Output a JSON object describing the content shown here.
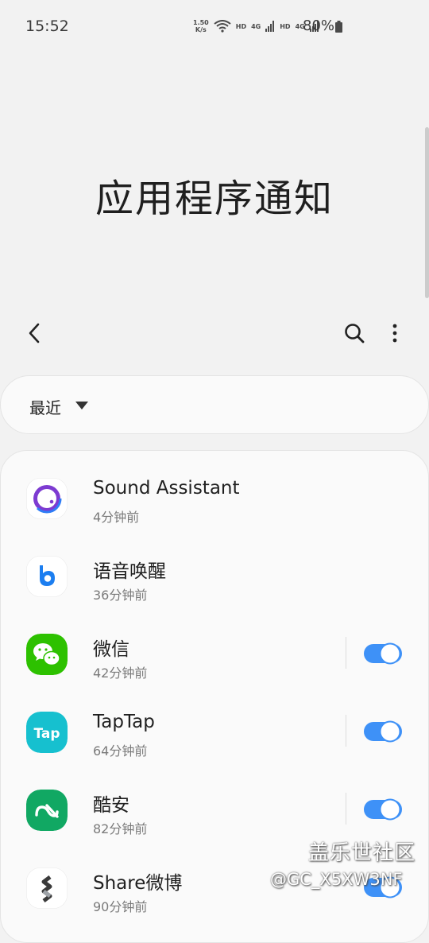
{
  "status_bar": {
    "time": "15:52",
    "net_speed_value": "1.50",
    "net_speed_unit": "K/s",
    "hd1": "HD",
    "hd2": "HD",
    "net1": "4G",
    "net2": "4G",
    "battery": "80%"
  },
  "page": {
    "title": "应用程序通知"
  },
  "filter": {
    "label": "最近"
  },
  "apps": [
    {
      "name": "Sound Assistant",
      "time": "4分钟前",
      "has_toggle": false,
      "icon": "sound-assistant-icon"
    },
    {
      "name": "语音唤醒",
      "time": "36分钟前",
      "has_toggle": false,
      "icon": "bixby-voice-icon"
    },
    {
      "name": "微信",
      "time": "42分钟前",
      "has_toggle": true,
      "toggle_on": true,
      "icon": "wechat-icon"
    },
    {
      "name": "TapTap",
      "time": "64分钟前",
      "has_toggle": true,
      "toggle_on": true,
      "icon": "taptap-icon"
    },
    {
      "name": "酷安",
      "time": "82分钟前",
      "has_toggle": true,
      "toggle_on": true,
      "icon": "coolapk-icon"
    },
    {
      "name": "Share微博",
      "time": "90分钟前",
      "has_toggle": true,
      "toggle_on": true,
      "icon": "share-weibo-icon"
    }
  ],
  "watermark": {
    "line1": "盖乐世社区",
    "line2": "@GC_X5XW3NF"
  },
  "colors": {
    "accent": "#3e91f7",
    "wechat": "#2dc100",
    "taptap": "#16c0cf",
    "coolapk": "#11a863"
  }
}
